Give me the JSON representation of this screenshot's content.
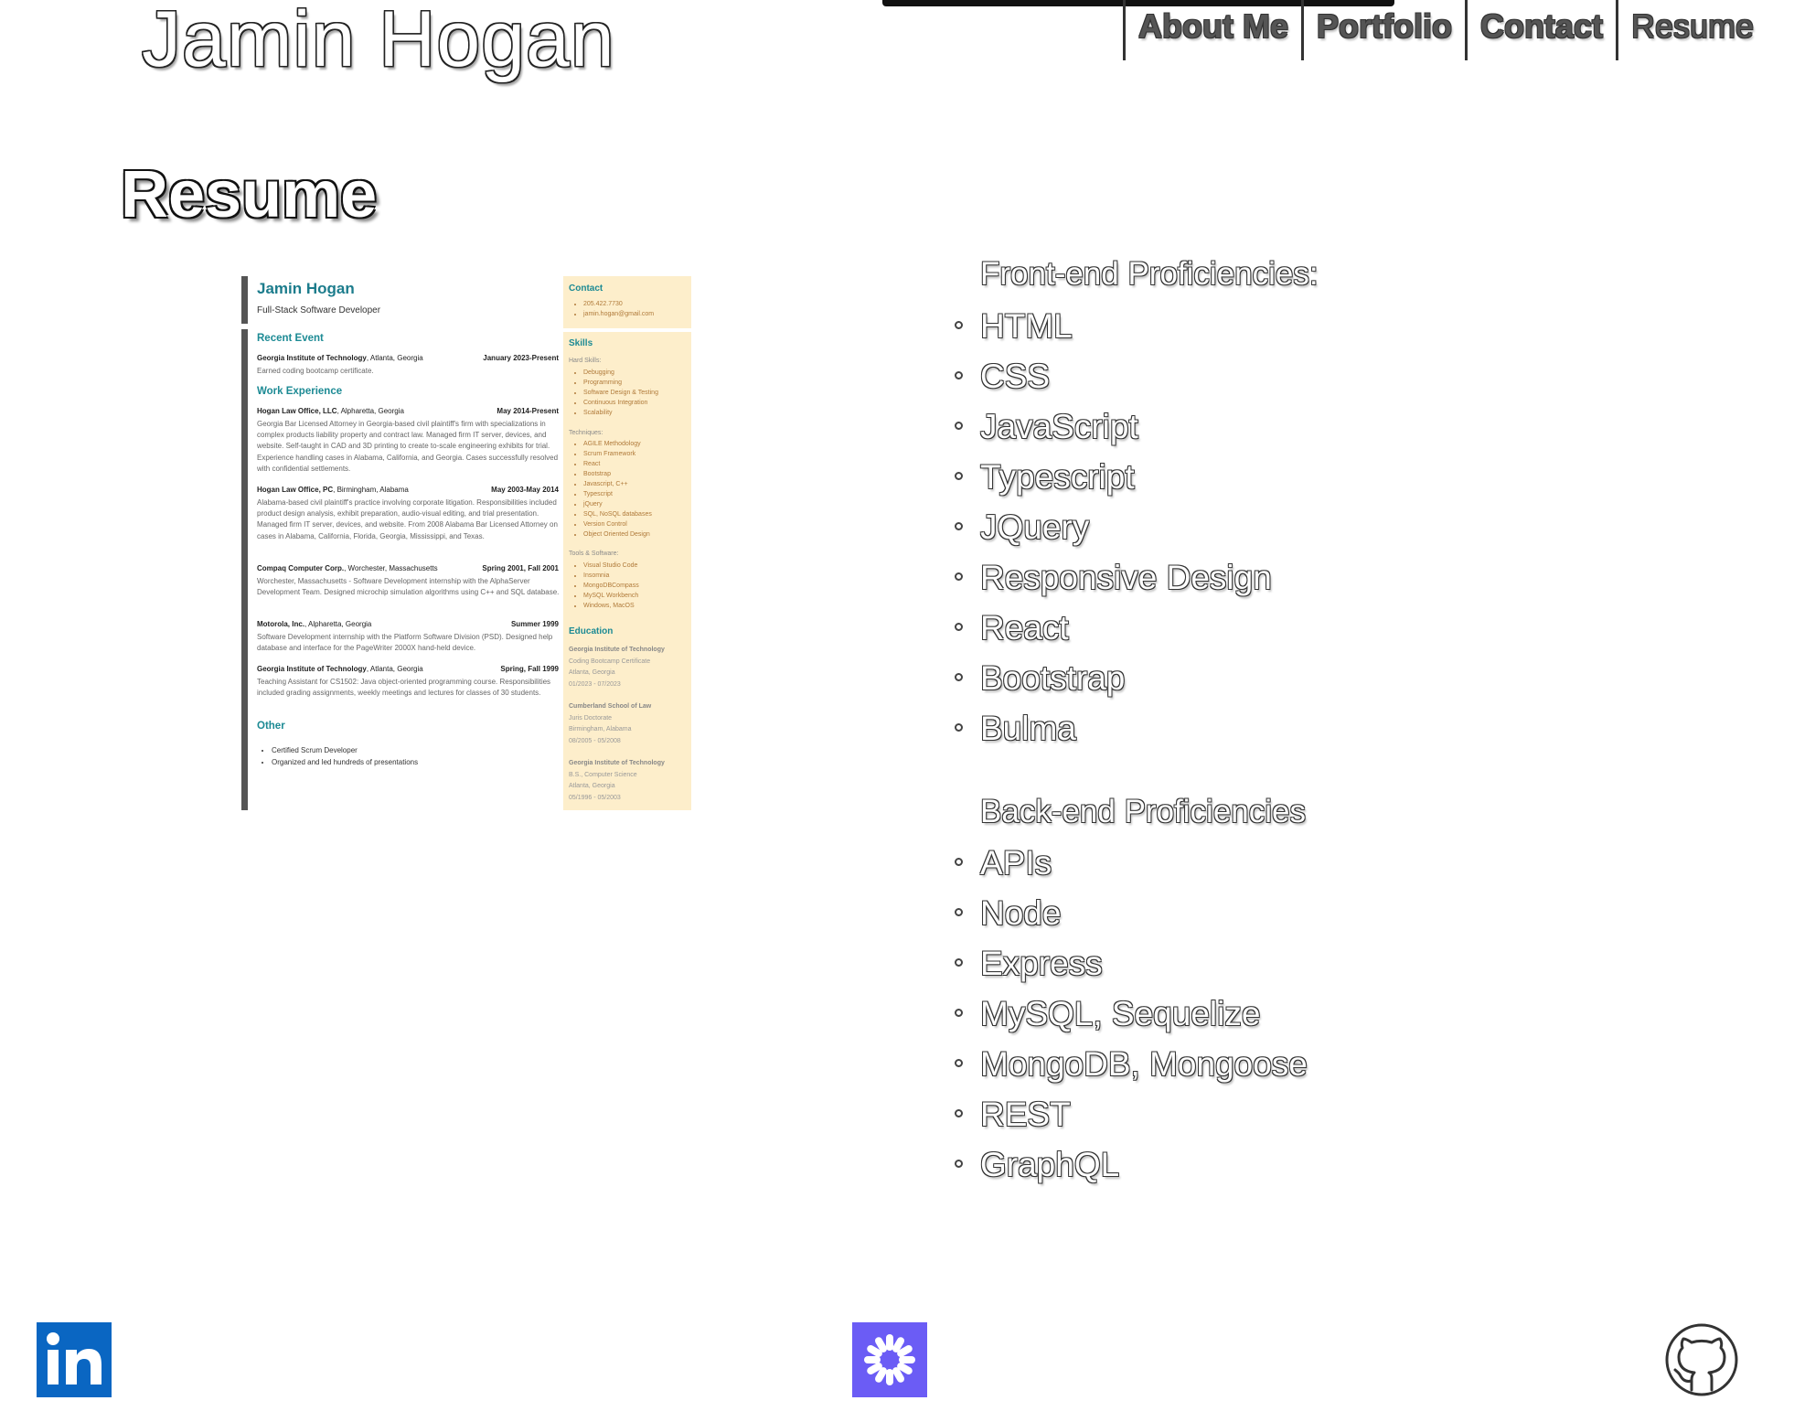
{
  "header": {
    "site_name": "Jamin Hogan",
    "nav": [
      {
        "label": "About Me",
        "active": false
      },
      {
        "label": "Portfolio",
        "active": false
      },
      {
        "label": "Contact",
        "active": false
      },
      {
        "label": "Resume",
        "active": true
      }
    ]
  },
  "main": {
    "section_title": "Resume",
    "resume_preview": {
      "name": "Jamin Hogan",
      "subtitle": "Full-Stack Software Developer",
      "recent_event_heading": "Recent Event",
      "recent_event": {
        "org": "Georgia Institute of Technology",
        "place": ", Atlanta, Georgia",
        "date": "January 2023-Present",
        "body": "Earned coding bootcamp certificate."
      },
      "work_heading": "Work Experience",
      "work": [
        {
          "org": "Hogan Law Office, LLC",
          "place": ", Alpharetta, Georgia",
          "date": "May 2014-Present",
          "body": "Georgia Bar Licensed Attorney in Georgia-based civil plaintiff's firm with specializations in complex products liability property and contract law. Managed firm IT server, devices, and website. Self-taught in CAD and 3D printing to create to-scale engineering exhibits for trial. Experience handling cases in Alabama, California, and Georgia. Cases successfully resolved with confidential settlements."
        },
        {
          "org": "Hogan Law Office, PC",
          "place": ", Birmingham, Alabama",
          "date": "May 2003-May 2014",
          "body": "Alabama-based civil plaintiff's practice involving corporate litigation. Responsibilities included product design analysis, exhibit preparation, audio-visual editing, and trial presentation. Managed firm IT server, devices, and website. From 2008 Alabama Bar Licensed Attorney on cases in Alabama, California, Florida, Georgia, Mississippi, and Texas."
        },
        {
          "org": "Compaq Computer Corp.",
          "place": ", Worchester, Massachusetts",
          "date": "Spring 2001, Fall 2001",
          "body": "Worchester, Massachusetts - Software Development internship with the AlphaServer Development Team. Designed microchip simulation algorithms using C++ and SQL database."
        },
        {
          "org": "Motorola, Inc.",
          "place": ", Alpharetta, Georgia",
          "date": "Summer 1999",
          "body": "Software Development internship with the Platform Software Division (PSD). Designed help database and interface for the PageWriter 2000X hand-held device."
        },
        {
          "org": "Georgia Institute of Technology",
          "place": ", Atlanta, Georgia",
          "date": "Spring, Fall 1999",
          "body": "Teaching Assistant for CS1502: Java object-oriented programming course. Responsibilities included grading assignments, weekly meetings and lectures for classes of 30 students."
        }
      ],
      "other_heading": "Other",
      "other": [
        "Certified Scrum Developer",
        "Organized and led hundreds of presentations"
      ],
      "contact_heading": "Contact",
      "contact": [
        "205.422.7730",
        "jamin.hogan@gmail.com"
      ],
      "skills_heading": "Skills",
      "hard_skills_label": "Hard Skills:",
      "hard_skills": [
        "Debugging",
        "Programming",
        "Software Design & Testing",
        "Continuous Integration",
        "Scalability"
      ],
      "techniques_label": "Techniques:",
      "techniques": [
        "AGILE Methodology",
        "Scrum Framework",
        "React",
        "Bootstrap",
        "Javascript, C++",
        "Typescript",
        "jQuery",
        "SQL, NoSQL databases",
        "Version Control",
        "Object Oriented Design"
      ],
      "tools_label": "Tools & Software:",
      "tools": [
        "Visual Studio Code",
        "Insomnia",
        "MongoDBCompass",
        "MySQL Workbench",
        "Windows, MacOS"
      ],
      "education_heading": "Education",
      "education": [
        {
          "school": "Georgia Institute of Technology",
          "line1": "Coding Bootcamp Certificate",
          "line2": "Atlanta, Georgia",
          "line3": "01/2023 - 07/2023"
        },
        {
          "school": "Cumberland School of Law",
          "line1": "Juris Doctorate",
          "line2": "Birmingham, Alabama",
          "line3": "08/2005 - 05/2008"
        },
        {
          "school": "Georgia Institute of Technology",
          "line1": "B.S., Computer Science",
          "line2": "Atlanta, Georgia",
          "line3": "05/1996 - 05/2003"
        }
      ]
    },
    "front_end": {
      "heading": "Front-end Proficiencies:",
      "items": [
        "HTML",
        "CSS",
        "JavaScript",
        "Typescript",
        "JQuery",
        "Responsive Design",
        "React",
        "Bootstrap",
        "Bulma"
      ]
    },
    "back_end": {
      "heading": "Back-end Proficiencies",
      "items": [
        "APIs",
        "Node",
        "Express",
        "MySQL, Sequelize",
        "MongoDB, Mongoose",
        "REST",
        "GraphQL"
      ]
    }
  },
  "footer": {
    "icons": [
      "linkedin-icon",
      "handshake-icon",
      "github-icon"
    ],
    "colors": {
      "linkedin": "#0a66c2",
      "handshake": "#6b5cf5"
    }
  }
}
